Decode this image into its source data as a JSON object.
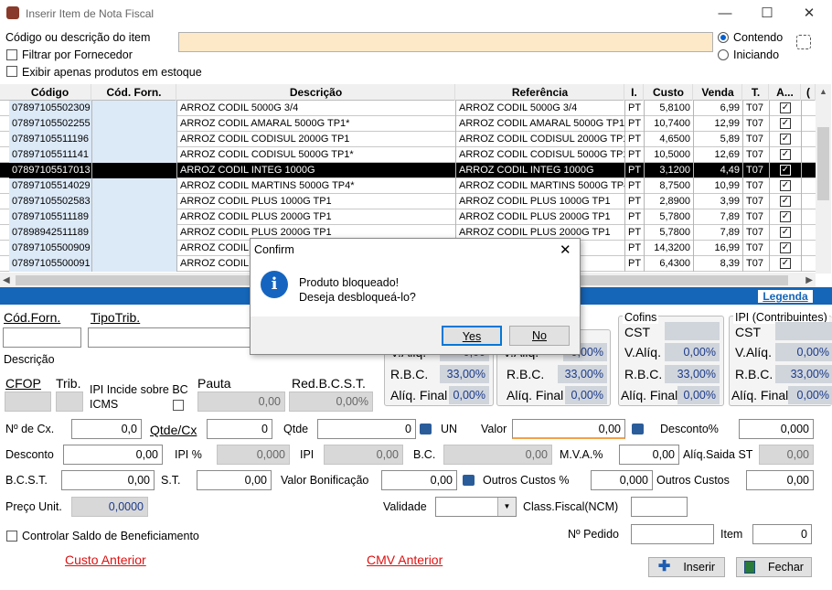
{
  "window": {
    "title": "Inserir Item de Nota Fiscal",
    "min": "—",
    "max": "☐",
    "close": "✕"
  },
  "search": {
    "label": "Código ou descrição do item",
    "value": "",
    "opt_contendo": "Contendo",
    "opt_iniciando": "Iniciando",
    "selected": "Contendo",
    "filter_fornecedor": "Filtrar por Fornecedor",
    "exibir_estoque": "Exibir apenas produtos em estoque"
  },
  "grid": {
    "headers": [
      "Código",
      "Cód. Forn.",
      "Descrição",
      "Referência",
      "I.",
      "Custo",
      "Venda",
      "T.",
      "A...",
      "("
    ],
    "rows": [
      {
        "codigo": "07897105502309",
        "forn": "",
        "desc": "ARROZ CODIL 5000G 3/4",
        "ref": "ARROZ CODIL 5000G 3/4",
        "i": "PT",
        "custo": "5,8100",
        "venda": "6,99",
        "t": "T07",
        "a": true
      },
      {
        "codigo": "07897105502255",
        "forn": "",
        "desc": "ARROZ CODIL AMARAL 5000G TP1*",
        "ref": "ARROZ CODIL AMARAL 5000G TP1*",
        "i": "PT",
        "custo": "10,7400",
        "venda": "12,99",
        "t": "T07",
        "a": true
      },
      {
        "codigo": "07897105511196",
        "forn": "",
        "desc": "ARROZ CODIL CODISUL 2000G TP1",
        "ref": "ARROZ CODIL CODISUL 2000G TP1",
        "i": "PT",
        "custo": "4,6500",
        "venda": "5,89",
        "t": "T07",
        "a": true
      },
      {
        "codigo": "07897105511141",
        "forn": "",
        "desc": "ARROZ CODIL CODISUL 5000G TP1*",
        "ref": "ARROZ CODIL CODISUL 5000G TP1*",
        "i": "PT",
        "custo": "10,5000",
        "venda": "12,69",
        "t": "T07",
        "a": true
      },
      {
        "codigo": "07897105517013",
        "forn": "",
        "desc": "ARROZ CODIL INTEG 1000G",
        "ref": "ARROZ CODIL INTEG 1000G",
        "i": "PT",
        "custo": "3,1200",
        "venda": "4,49",
        "t": "T07",
        "a": true,
        "selected": true
      },
      {
        "codigo": "07897105514029",
        "forn": "",
        "desc": "ARROZ CODIL MARTINS 5000G TP4*",
        "ref": "ARROZ CODIL MARTINS 5000G TP4*",
        "i": "PT",
        "custo": "8,7500",
        "venda": "10,99",
        "t": "T07",
        "a": true
      },
      {
        "codigo": "07897105502583",
        "forn": "",
        "desc": "ARROZ CODIL PLUS 1000G TP1",
        "ref": "ARROZ CODIL PLUS 1000G TP1",
        "i": "PT",
        "custo": "2,8900",
        "venda": "3,99",
        "t": "T07",
        "a": true
      },
      {
        "codigo": "07897105511189",
        "forn": "",
        "desc": "ARROZ CODIL PLUS 2000G TP1",
        "ref": "ARROZ CODIL PLUS 2000G TP1",
        "i": "PT",
        "custo": "5,7800",
        "venda": "7,89",
        "t": "T07",
        "a": true
      },
      {
        "codigo": "07898942511189",
        "forn": "",
        "desc": "ARROZ CODIL PLUS 2000G TP1",
        "ref": "ARROZ CODIL PLUS 2000G TP1",
        "i": "PT",
        "custo": "5,7800",
        "venda": "7,89",
        "t": "T07",
        "a": true
      },
      {
        "codigo": "07897105500909",
        "forn": "",
        "desc": "ARROZ CODIL P",
        "ref": "TP1*",
        "i": "PT",
        "custo": "14,3200",
        "venda": "16,99",
        "t": "T07",
        "a": true
      },
      {
        "codigo": "07897105500091",
        "forn": "",
        "desc": "ARROZ CODIL S",
        "ref": "TO 5000G",
        "i": "PT",
        "custo": "6,4300",
        "venda": "8,39",
        "t": "T07",
        "a": true
      }
    ]
  },
  "legenda": "Legenda",
  "form": {
    "cod_forn": "Cód.Forn.",
    "tipo_trib": "TipoTrib.",
    "descricao": "Descrição",
    "cfop": "CFOP",
    "trib": "Trib.",
    "ipi_incide": "IPI Incide sobre BC ICMS",
    "pauta": "Pauta",
    "pauta_val": "0,00",
    "red_bcst": "Red.B.C.S.T.",
    "red_bcst_val": "0,00%",
    "icms": {
      "valiq": "V.Aliq.",
      "valiq_val": "0,00",
      "rbc": "R.B.C.",
      "rbc_val": "33,00%",
      "aliq_final": "Alíq. Final",
      "aliq_final_val": "0,00%"
    },
    "pis": {
      "valiq": "V.Aliq.",
      "valiq_val": "0,00%",
      "rbc": "R.B.C.",
      "rbc_val": "33,00%",
      "aliq_final": "Alíq. Final",
      "aliq_final_val": "0,00%"
    },
    "cofins": {
      "title": "Cofins",
      "cst": "CST",
      "valiq": "V.Alíq.",
      "valiq_val": "0,00%",
      "rbc": "R.B.C.",
      "rbc_val": "33,00%",
      "aliq_final": "Alíq. Final",
      "aliq_final_val": "0,00%"
    },
    "ipi": {
      "title": "IPI (Contribuintes)",
      "cst": "CST",
      "valiq": "V.Alíq.",
      "valiq_val": "0,00%",
      "rbc": "R.B.C.",
      "rbc_val": "33,00%",
      "aliq_final": "Alíq. Final",
      "aliq_final_val": "0,00%"
    },
    "n_cx": "Nº de Cx.",
    "n_cx_val": "0,0",
    "qtde_cx": "Qtde/Cx",
    "qtde_cx_val": "0",
    "qtde": "Qtde",
    "qtde_val": "0",
    "un": "UN",
    "valor": "Valor",
    "valor_val": "0,00",
    "desconto_pct": "Desconto%",
    "desconto_pct_val": "0,000",
    "desconto": "Desconto",
    "desconto_val": "0,00",
    "ipi_pct": "IPI %",
    "ipi_pct_val": "0,000",
    "ipi_lbl": "IPI",
    "ipi_val": "0,00",
    "bc": "B.C.",
    "bc_val": "0,00",
    "mva": "M.V.A.%",
    "mva_val": "0,00",
    "aliq_saida": "Alíq.Saida ST",
    "aliq_saida_val": "0,00",
    "bcst": "B.C.S.T.",
    "bcst_val": "0,00",
    "st": "S.T.",
    "st_val": "0,00",
    "valor_bonif": "Valor Bonificação",
    "valor_bonif_val": "0,00",
    "outros_pct": "Outros Custos %",
    "outros_pct_val": "0,000",
    "outros": "Outros Custos",
    "outros_val": "0,00",
    "preco_unit": "Preço Unit.",
    "preco_unit_val": "0,0000",
    "validade": "Validade",
    "class_fiscal": "Class.Fiscal(NCM)",
    "controlar": "Controlar Saldo de Beneficiamento",
    "n_pedido": "Nº Pedido",
    "item": "Item",
    "item_val": "0",
    "custo_anterior": "Custo Anterior",
    "cmv_anterior": "CMV Anterior",
    "inserir": "Inserir",
    "fechar": "Fechar"
  },
  "dialog": {
    "title": "Confirm",
    "line1": "Produto bloqueado!",
    "line2": "Deseja desbloqueá-lo?",
    "yes": "Yes",
    "no": "No"
  }
}
